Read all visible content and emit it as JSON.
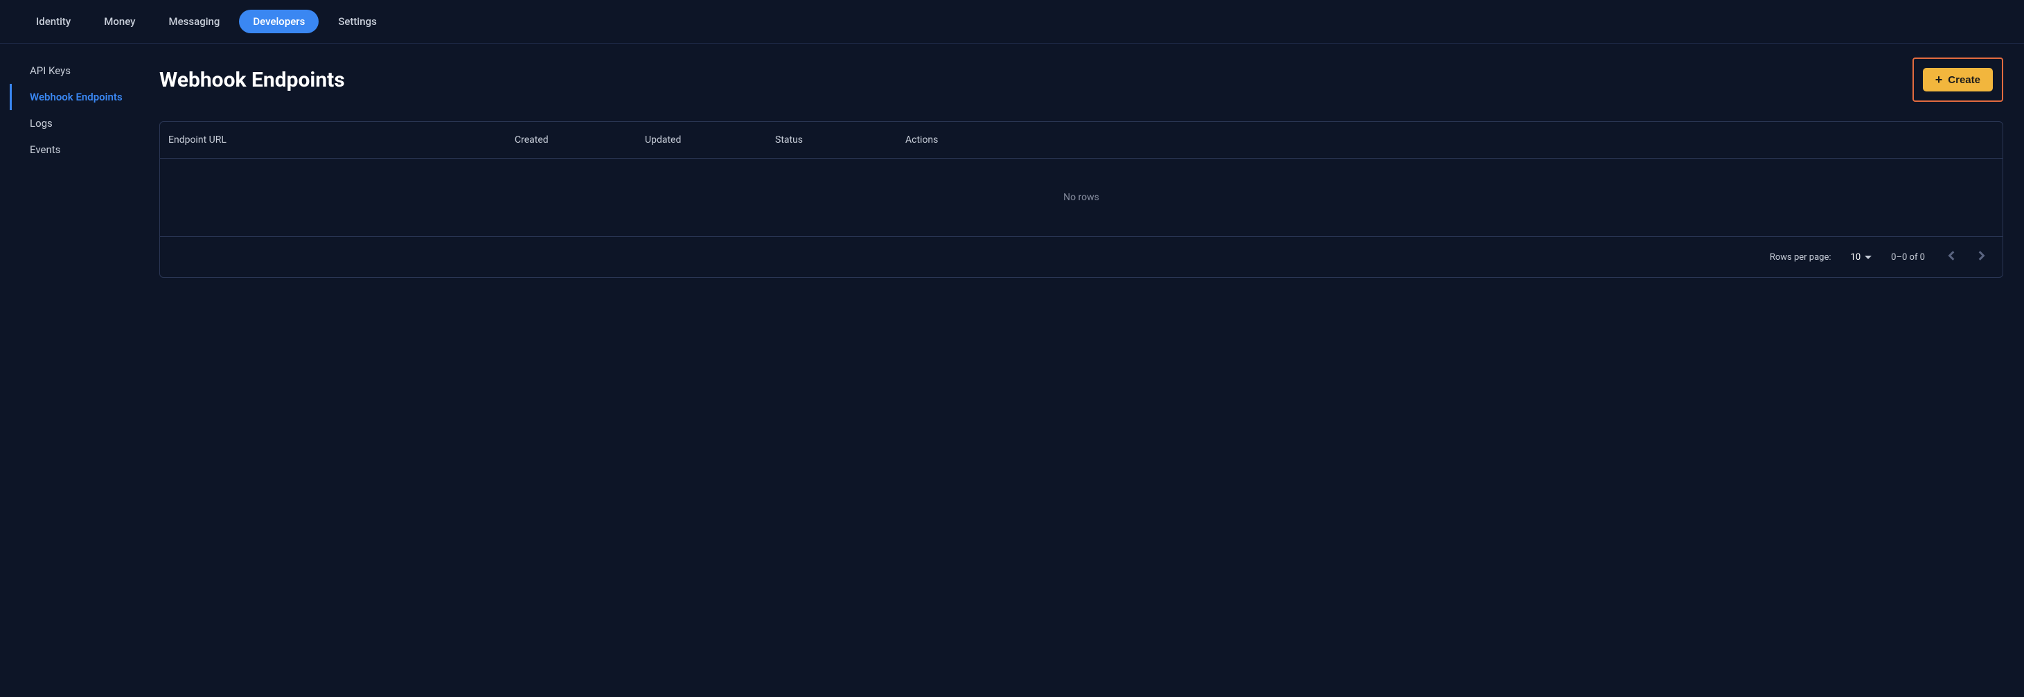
{
  "topnav": {
    "items": [
      {
        "label": "Identity"
      },
      {
        "label": "Money"
      },
      {
        "label": "Messaging"
      },
      {
        "label": "Developers",
        "active": true
      },
      {
        "label": "Settings"
      }
    ]
  },
  "sidebar": {
    "items": [
      {
        "label": "API Keys"
      },
      {
        "label": "Webhook Endpoints",
        "active": true
      },
      {
        "label": "Logs"
      },
      {
        "label": "Events"
      }
    ]
  },
  "page": {
    "title": "Webhook Endpoints",
    "create_label": "Create"
  },
  "table": {
    "columns": {
      "endpoint_url": "Endpoint URL",
      "created": "Created",
      "updated": "Updated",
      "status": "Status",
      "actions": "Actions"
    },
    "empty_message": "No rows"
  },
  "pagination": {
    "rows_per_page_label": "Rows per page:",
    "rows_per_page_value": "10",
    "range_text": "0–0 of 0"
  }
}
